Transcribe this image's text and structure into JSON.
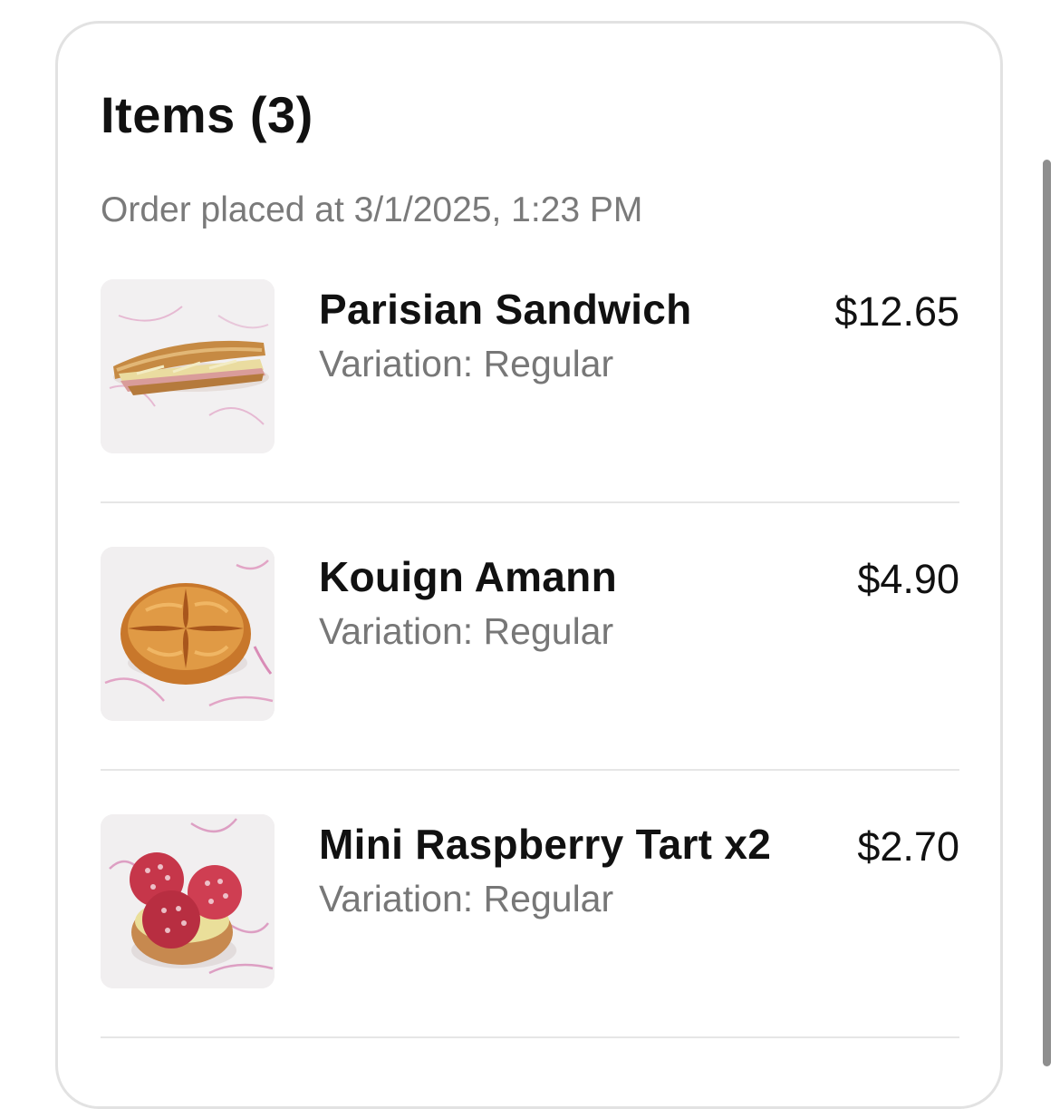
{
  "items_section": {
    "title": "Items (3)",
    "order_time": "Order placed at 3/1/2025, 1:23 PM",
    "items": [
      {
        "name": "Parisian Sandwich",
        "variation": "Variation: Regular",
        "price": "$12.65",
        "image": "sandwich-image"
      },
      {
        "name": "Kouign Amann",
        "variation": "Variation: Regular",
        "price": "$4.90",
        "image": "pastry-image"
      },
      {
        "name": "Mini Raspberry Tart x2",
        "variation": "Variation: Regular",
        "price": "$2.70",
        "image": "raspberry-tart-image"
      }
    ]
  },
  "colors": {
    "title_text": "#111111",
    "secondary_text": "#777777",
    "card_border": "#e2e2e2",
    "divider": "#e6e6e6",
    "scrollbar": "#8e8e8e"
  }
}
